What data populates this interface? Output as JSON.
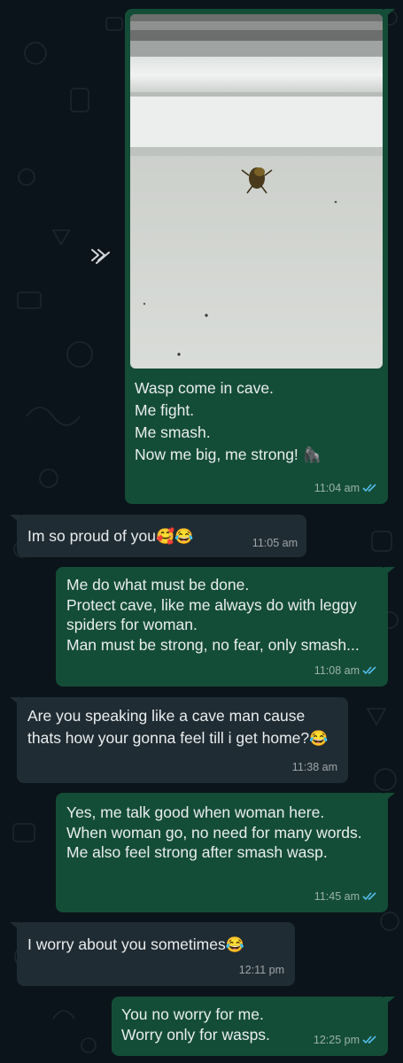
{
  "messages": [
    {
      "direction": "outgoing",
      "has_image": true,
      "image_alt": "Photo of a wasp on a white wall below a window sill",
      "text": "Wasp come in cave.\nMe fight.\nMe smash.\nNow me big, me strong! ",
      "emoji": "🦍",
      "time": "11:04 am",
      "status": "read"
    },
    {
      "direction": "incoming",
      "text": "Im so proud of you",
      "emoji": "🥰😂",
      "time": "11:05 am"
    },
    {
      "direction": "outgoing",
      "text": "Me do what must be done.\nProtect cave, like me always do with leggy spiders for woman.\nMan must be strong, no fear, only smash...",
      "time": "11:08 am",
      "status": "read"
    },
    {
      "direction": "incoming",
      "text": "Are you speaking like a cave man cause thats how your gonna feel till i get home?",
      "emoji": "😂",
      "time": "11:38 am"
    },
    {
      "direction": "outgoing",
      "text": "Yes, me talk good when woman here.\nWhen woman go, no need for many words.\nMe also feel strong after smash wasp.",
      "time": "11:45 am",
      "status": "read"
    },
    {
      "direction": "incoming",
      "text": "I worry about you sometimes",
      "emoji": "😂",
      "time": "12:11 pm"
    },
    {
      "direction": "outgoing",
      "text": "You no worry for me.\nWorry only for wasps.",
      "time": "12:25 pm",
      "status": "read"
    }
  ],
  "icons": {
    "forward": "forward-icon",
    "read_receipt": "double-check-icon"
  },
  "colors": {
    "background": "#0b141a",
    "outgoing_bubble": "#144d37",
    "incoming_bubble": "#202c33",
    "read_tick": "#53bdeb"
  }
}
